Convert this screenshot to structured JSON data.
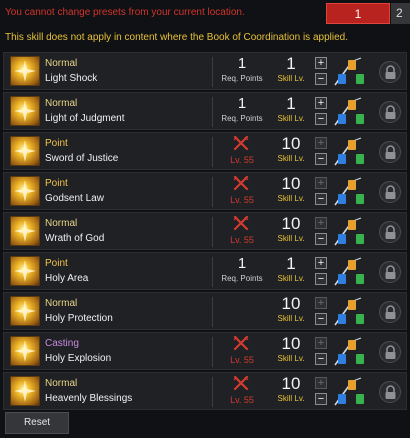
{
  "header": {
    "location_warning": "You cannot change presets from your current location.",
    "tabs": [
      {
        "label": "1",
        "active": true
      },
      {
        "label": "2",
        "active": false
      }
    ],
    "book_warning": "This skill does not apply in content where the Book of Coordination is applied."
  },
  "labels": {
    "req_points": "Req. Points",
    "skill_lv": "Skill Lv.",
    "plus": "+",
    "minus": "−"
  },
  "colors": {
    "warning_red": "#d2332c",
    "warning_yellow": "#e6c13a",
    "active_tab": "#b8221f",
    "tripod_orange": "#e8a02a",
    "tripod_blue": "#2e7fe0",
    "tripod_green": "#37b24d"
  },
  "skills": [
    {
      "type": "Normal",
      "name": "Light Shock",
      "req_points": "1",
      "locked": false,
      "level": "1",
      "icon": "light-shock-icon"
    },
    {
      "type": "Normal",
      "name": "Light of Judgment",
      "req_points": "1",
      "locked": false,
      "level": "1",
      "icon": "light-of-judgment-icon"
    },
    {
      "type": "Point",
      "name": "Sword of Justice",
      "req_level": "Lv. 55",
      "locked": true,
      "level": "10",
      "icon": "sword-of-justice-icon"
    },
    {
      "type": "Point",
      "name": "Godsent Law",
      "req_level": "Lv. 55",
      "locked": true,
      "level": "10",
      "icon": "godsent-law-icon"
    },
    {
      "type": "Normal",
      "name": "Wrath of God",
      "req_level": "Lv. 55",
      "locked": true,
      "level": "10",
      "icon": "wrath-of-god-icon"
    },
    {
      "type": "Point",
      "name": "Holy Area",
      "req_points": "1",
      "locked": false,
      "level": "1",
      "icon": "holy-area-icon"
    },
    {
      "type": "Normal",
      "name": "Holy Protection",
      "locked": false,
      "level": "10",
      "icon": "holy-protection-icon"
    },
    {
      "type": "Casting",
      "name": "Holy Explosion",
      "req_level": "Lv. 55",
      "locked": true,
      "level": "10",
      "icon": "holy-explosion-icon"
    },
    {
      "type": "Normal",
      "name": "Heavenly Blessings",
      "req_level": "Lv. 55",
      "locked": true,
      "level": "10",
      "icon": "heavenly-blessings-icon"
    }
  ],
  "footer": {
    "reset_label": "Reset"
  }
}
